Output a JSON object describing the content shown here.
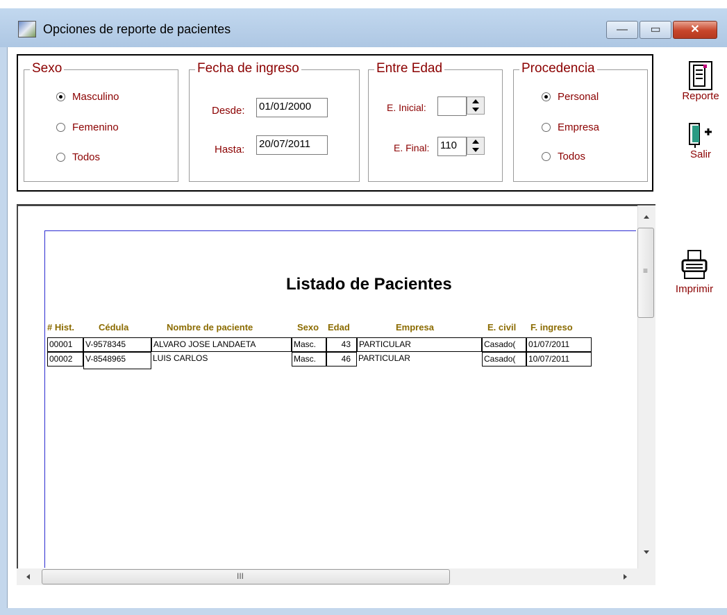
{
  "window": {
    "title": "Opciones de reporte de pacientes",
    "controls": {
      "minimize": "—",
      "maximize": "▭",
      "close": "✕"
    },
    "icons": {
      "app": "app-window-icon"
    }
  },
  "filters": {
    "sexo": {
      "legend": "Sexo",
      "options": [
        {
          "label": "Masculino",
          "selected": true
        },
        {
          "label": "Femenino",
          "selected": false
        },
        {
          "label": "Todos",
          "selected": false
        }
      ]
    },
    "fecha": {
      "legend": "Fecha de ingreso",
      "desde_label": "Desde:",
      "desde_value": "01/01/2000",
      "hasta_label": "Hasta:",
      "hasta_value": "20/07/2011"
    },
    "edad": {
      "legend": "Entre Edad",
      "inicial_label": "E. Inicial:",
      "inicial_value": "",
      "final_label": "E. Final:",
      "final_value": "110"
    },
    "procedencia": {
      "legend": "Procedencia",
      "options": [
        {
          "label": "Personal",
          "selected": true
        },
        {
          "label": "Empresa",
          "selected": false
        },
        {
          "label": "Todos",
          "selected": false
        }
      ]
    }
  },
  "side": {
    "reporte_label": "Reporte",
    "salir_label": "Salir",
    "imprimir_label": "Imprimir",
    "icons": {
      "reporte": "report-document-icon",
      "salir": "exit-door-icon",
      "imprimir": "printer-icon"
    }
  },
  "report": {
    "title": "Listado de Pacientes",
    "columns": [
      "# Hist.",
      "Cédula",
      "Nombre de paciente",
      "Sexo",
      "Edad",
      "Empresa",
      "E. civil",
      "F. ingreso"
    ],
    "rows": [
      {
        "hist": "00001",
        "cedula": "V-9578345",
        "nombre": "ALVARO JOSE LANDAETA",
        "sexo": "Masc.",
        "edad": "43",
        "empresa": "PARTICULAR",
        "civil": "Casado(",
        "ingreso": "01/07/2011"
      },
      {
        "hist": "00002",
        "cedula": "V-8548965",
        "nombre": "LUIS CARLOS",
        "sexo": "Masc.",
        "edad": "46",
        "empresa": "PARTICULAR",
        "civil": "Casado(",
        "ingreso": "10/07/2011"
      }
    ]
  },
  "scroll": {
    "hmark": "III",
    "vmark": "≡"
  },
  "colors": {
    "label": "#8b0000",
    "header": "#8b6b00",
    "titlebar": "#b9d1ea",
    "close": "#c7452a"
  }
}
